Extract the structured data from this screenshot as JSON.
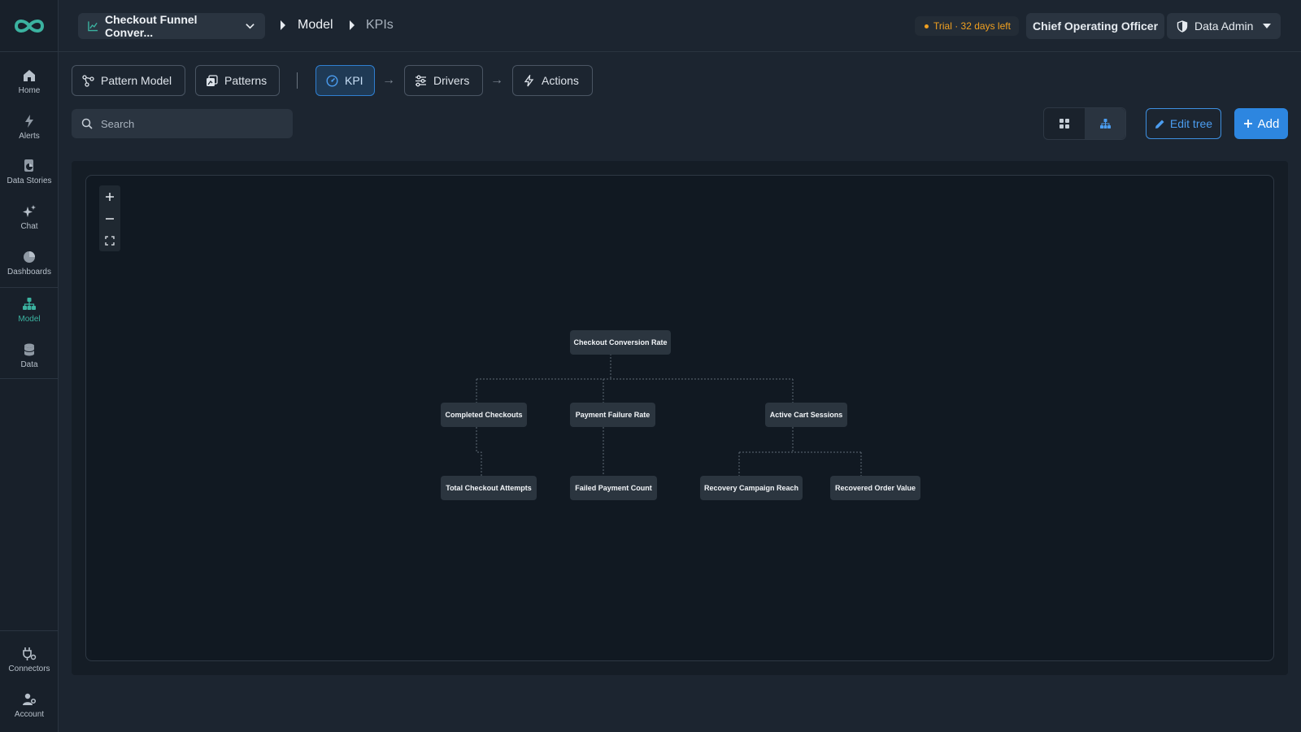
{
  "header": {
    "model_name": "Checkout Funnel Conver...",
    "breadcrumb": [
      "Model",
      "KPIs"
    ],
    "trial_text": "Trial · 32 days left",
    "role": "Chief Operating Officer",
    "user": "Data Admin"
  },
  "sidebar": {
    "items": [
      {
        "label": "Home",
        "icon": "home-icon"
      },
      {
        "label": "Alerts",
        "icon": "bolt-icon"
      },
      {
        "label": "Data Stories",
        "icon": "data-stories-icon"
      },
      {
        "label": "Chat",
        "icon": "sparkle-icon"
      },
      {
        "label": "Dashboards",
        "icon": "pie-icon"
      },
      {
        "label": "Model",
        "icon": "hierarchy-icon"
      },
      {
        "label": "Data",
        "icon": "database-icon"
      }
    ],
    "bottom_items": [
      {
        "label": "Connectors",
        "icon": "plug-icon"
      },
      {
        "label": "Account",
        "icon": "user-gear-icon"
      }
    ]
  },
  "tabs": {
    "pattern_model": "Pattern Model",
    "patterns": "Patterns",
    "kpi": "KPI",
    "drivers": "Drivers",
    "actions": "Actions"
  },
  "toolbar": {
    "search_placeholder": "Search",
    "edit_tree": "Edit tree",
    "add": "Add"
  },
  "tree": {
    "root": "Checkout Conversion Rate",
    "level1": [
      "Completed Checkouts",
      "Payment Failure Rate",
      "Active Cart Sessions"
    ],
    "level2": [
      "Total Checkout Attempts",
      "Failed Payment Count",
      "Recovery Campaign Reach",
      "Recovered Order Value"
    ]
  },
  "colors": {
    "accent": "#2d86e0",
    "active_nav": "#3bb2a0",
    "trial": "#f0a020",
    "background": "#1c2530"
  }
}
